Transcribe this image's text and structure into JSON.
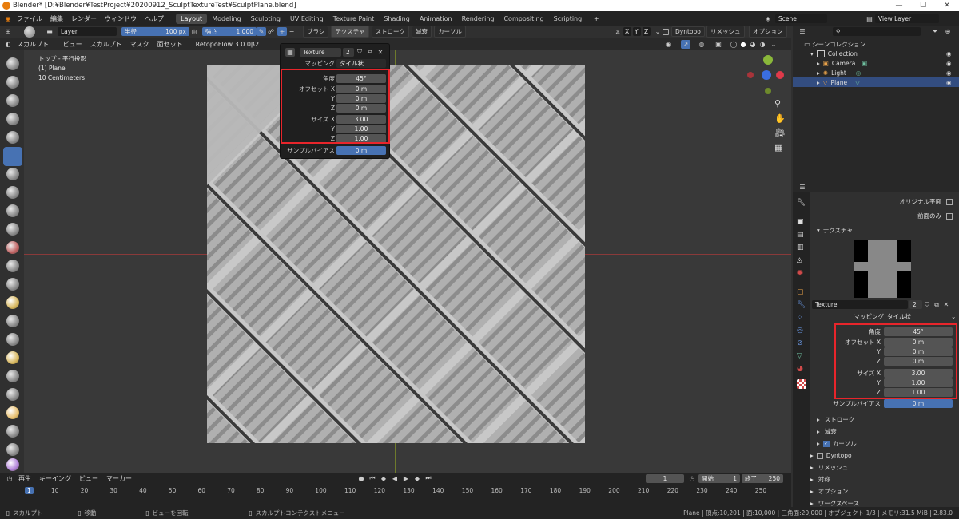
{
  "title": "Blender* [D:¥Blender¥TestProject¥20200912_SculptTextureTest¥SculptPlane.blend]",
  "menu": [
    "ファイル",
    "編集",
    "レンダー",
    "ウィンドウ",
    "ヘルプ"
  ],
  "workspaces": [
    "Layout",
    "Modeling",
    "Sculpting",
    "UV Editing",
    "Texture Paint",
    "Shading",
    "Animation",
    "Rendering",
    "Compositing",
    "Scripting"
  ],
  "scene": "Scene",
  "view_layer": "View Layer",
  "header": {
    "layer": "Layer",
    "radius_label": "半径",
    "radius_value": "100 px",
    "strength_label": "強さ",
    "strength_value": "1.000",
    "brush": "ブラシ",
    "texture": "テクスチャ",
    "stroke": "ストローク",
    "falloff": "減衰",
    "cursor": "カーソル",
    "x": "X",
    "y": "Y",
    "z": "Z",
    "dyntopo": "Dyntopo",
    "remesh": "リメッシュ",
    "options": "オプション"
  },
  "header2": {
    "mode": "スカルプト...",
    "view": "ビュー",
    "sculpt": "スカルプト",
    "mask": "マスク",
    "face_set": "面セット",
    "addon": "RetopoFlow 3.0.0β2"
  },
  "viewport_info": [
    "トップ - 平行投影",
    "(1) Plane",
    "10 Centimeters"
  ],
  "popup": {
    "texture_name": "Texture",
    "users": "2",
    "mapping_label": "マッピング",
    "mapping_value": "タイル状",
    "angle_label": "角度",
    "angle": "45°",
    "offset_label": "オフセット X",
    "offset_x": "0 m",
    "offset_y": "0 m",
    "offset_z": "0 m",
    "size_label": "サイズ X",
    "size_x": "3.00",
    "size_y": "1.00",
    "size_z": "1.00",
    "y": "Y",
    "z": "Z",
    "bias_label": "サンプルバイアス",
    "bias": "0 m"
  },
  "outliner": {
    "root": "シーンコレクション",
    "collection": "Collection",
    "items": [
      "Camera",
      "Light",
      "Plane"
    ]
  },
  "props": {
    "original_plane": "オリジナル平面",
    "front_only": "前面のみ",
    "texture_section": "テクスチャ",
    "texture_name": "Texture",
    "users": "2",
    "mapping_label": "マッピング",
    "mapping_value": "タイル状",
    "angle_label": "角度",
    "angle": "45°",
    "offset_label": "オフセット X",
    "offset_x": "0 m",
    "offset_y": "0 m",
    "offset_z": "0 m",
    "size_label": "サイズ X",
    "size_x": "3.00",
    "size_y": "1.00",
    "size_z": "1.00",
    "y": "Y",
    "z": "Z",
    "bias_label": "サンプルバイアス",
    "bias": "0 m",
    "sections": [
      "ストローク",
      "減衰",
      "カーソル",
      "Dyntopo",
      "リメッシュ",
      "対称",
      "オプション",
      "ワークスペース"
    ]
  },
  "timeline": {
    "playback": "再生",
    "keying": "キーイング",
    "view": "ビュー",
    "marker": "マーカー",
    "current": "1",
    "start_label": "開始",
    "start": "1",
    "end_label": "終了",
    "end": "250",
    "ticks": [
      "1",
      "10",
      "20",
      "30",
      "40",
      "50",
      "60",
      "70",
      "80",
      "90",
      "100",
      "110",
      "120",
      "130",
      "140",
      "150",
      "160",
      "170",
      "180",
      "190",
      "200",
      "210",
      "220",
      "230",
      "240",
      "250"
    ]
  },
  "status": {
    "sculpt": "スカルプト",
    "move": "移動",
    "rotate": "ビューを回転",
    "context": "スカルプトコンテクストメニュー",
    "stats": "Plane | 頂点:10,201 | 面:10,000 | 三角面:20,000 | オブジェクト:1/3 | メモリ:31.5 MiB | 2.83.0"
  },
  "colors": {
    "accent": "#4772b3",
    "highlight": "#e8252b",
    "selected": "#334d80"
  }
}
